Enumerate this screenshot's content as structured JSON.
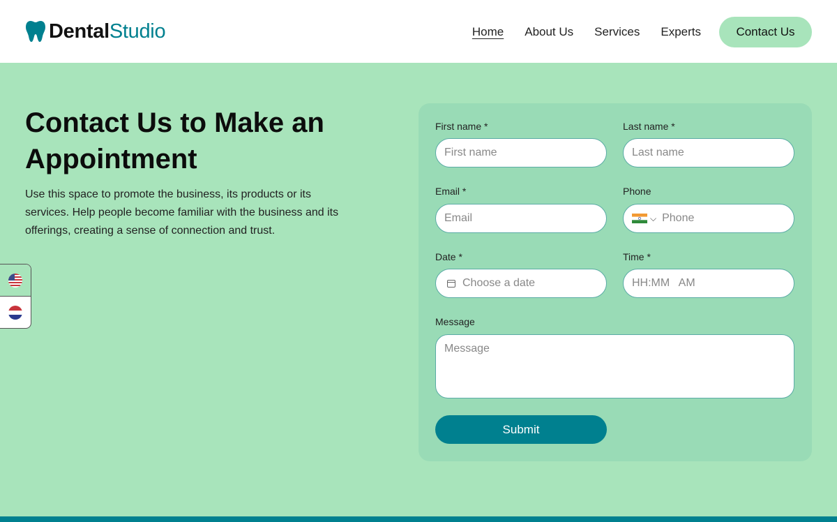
{
  "brand": {
    "name_bold": "Dental",
    "name_light": "Studio",
    "icon": "tooth-icon",
    "accent": "#00808f"
  },
  "nav": {
    "items": [
      {
        "label": "Home",
        "active": true
      },
      {
        "label": "About Us",
        "active": false
      },
      {
        "label": "Services",
        "active": false
      },
      {
        "label": "Experts",
        "active": false
      }
    ],
    "cta_label": "Contact Us"
  },
  "hero": {
    "title": "Contact Us to Make an Appointment",
    "description": "Use this space to promote the business, its products or its services. Help people become familiar with the business and its offerings, creating a sense of connection and trust."
  },
  "languages": [
    {
      "icon": "us-flag-icon",
      "selected": true
    },
    {
      "icon": "fr-flag-icon",
      "selected": false
    }
  ],
  "form": {
    "first_name": {
      "label": "First name *",
      "placeholder": "First name"
    },
    "last_name": {
      "label": "Last name *",
      "placeholder": "Last name"
    },
    "email": {
      "label": "Email *",
      "placeholder": "Email"
    },
    "phone": {
      "label": "Phone",
      "placeholder": "Phone",
      "country_icon": "india-flag-icon"
    },
    "date": {
      "label": "Date *",
      "placeholder": "Choose a date"
    },
    "time": {
      "label": "Time *",
      "placeholder": "HH:MM   AM"
    },
    "message": {
      "label": "Message",
      "placeholder": "Message"
    },
    "submit_label": "Submit"
  },
  "colors": {
    "background": "#a8e4bb",
    "card": "#99dbb6",
    "primary": "#00808f"
  }
}
